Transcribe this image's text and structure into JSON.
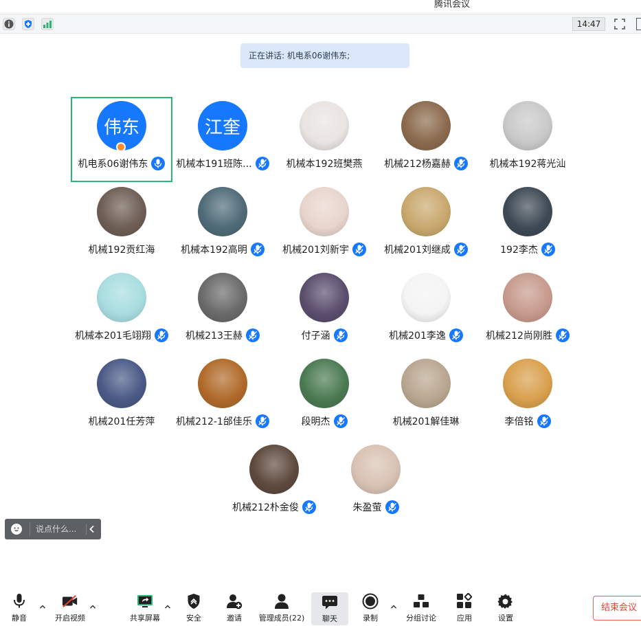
{
  "window": {
    "title": "腾讯会议"
  },
  "infobar": {
    "time": "14:47"
  },
  "banner": {
    "speaking": "正在讲话: 机电系06谢伟东;"
  },
  "participants": [
    {
      "name": "机电系06谢伟东",
      "avatar_text": "伟东",
      "avatar_color": "#1677ff",
      "host": true,
      "active": true,
      "mic": "on"
    },
    {
      "name": "机械本191班陈...",
      "avatar_text": "江奎",
      "avatar_color": "#1677ff",
      "mic": "muted"
    },
    {
      "name": "机械本192班樊燕",
      "avatar_bg": "#e9e4e1",
      "mic": "none"
    },
    {
      "name": "机械212杨嘉赫",
      "avatar_bg": "#8b6a4e",
      "mic": "muted"
    },
    {
      "name": "机械本192蒋光汕",
      "avatar_bg": "#c9c9c9",
      "mic": "none"
    },
    {
      "name": "机械192贡红海",
      "avatar_bg": "#6e5e55",
      "mic": "none"
    },
    {
      "name": "机械本192高明",
      "avatar_bg": "#4f6b78",
      "mic": "muted"
    },
    {
      "name": "机械201刘新宇",
      "avatar_bg": "#e8d5cd",
      "mic": "muted"
    },
    {
      "name": "机械201刘继成",
      "avatar_bg": "#c9a86e",
      "mic": "muted"
    },
    {
      "name": "192李杰",
      "avatar_bg": "#3f4a55",
      "mic": "muted"
    },
    {
      "name": "机械本201毛翊翔",
      "avatar_bg": "#a8dde0",
      "mic": "muted"
    },
    {
      "name": "机械213王赫",
      "avatar_bg": "#6a6a6a",
      "mic": "muted"
    },
    {
      "name": "付子涵",
      "avatar_bg": "#5b4e6e",
      "mic": "muted"
    },
    {
      "name": "机械201李逸",
      "avatar_bg": "#f4f4f4",
      "mic": "muted"
    },
    {
      "name": "机械212尚刚胜",
      "avatar_bg": "#c79a8d",
      "mic": "muted"
    },
    {
      "name": "机械201任芳萍",
      "avatar_bg": "#4a5a86",
      "mic": "none"
    },
    {
      "name": "机械212-1邰佳乐",
      "avatar_bg": "#b06a2a",
      "mic": "muted"
    },
    {
      "name": "段明杰",
      "avatar_bg": "#4b7a52",
      "mic": "muted"
    },
    {
      "name": "机械201解佳琳",
      "avatar_bg": "#b9a690",
      "mic": "none"
    },
    {
      "name": "李倍铭",
      "avatar_bg": "#d9a04e",
      "mic": "muted"
    },
    {
      "name": "机械212朴金俊",
      "avatar_bg": "#5e4a3e",
      "mic": "muted"
    },
    {
      "name": "朱盈萤",
      "avatar_bg": "#d8c2b3",
      "mic": "muted"
    }
  ],
  "chat": {
    "placeholder": "说点什么..."
  },
  "toolbar": {
    "mute": "静音",
    "video": "开启视频",
    "share": "共享屏幕",
    "security": "安全",
    "invite": "邀请",
    "members": "管理成员(22)",
    "chat": "聊天",
    "record": "录制",
    "breakout": "分组讨论",
    "apps": "应用",
    "settings": "设置",
    "end": "结束会议"
  },
  "colors": {
    "accent": "#1677ff",
    "active_border": "#2bb673",
    "end": "#e8412f"
  }
}
